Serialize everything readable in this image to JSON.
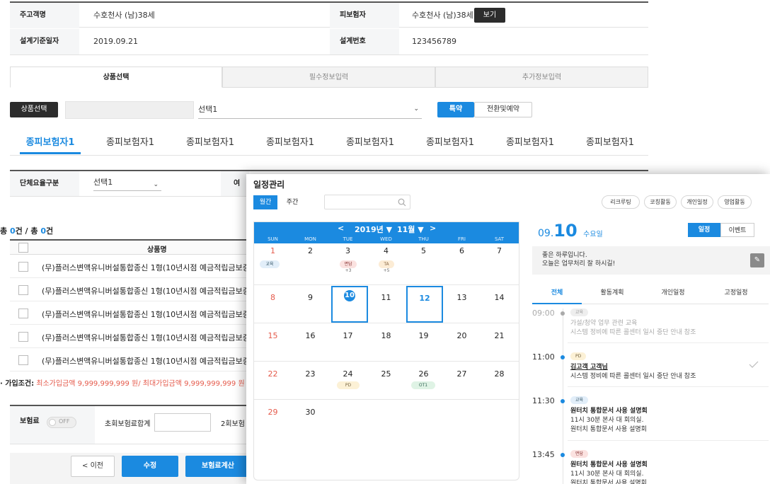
{
  "colors": {
    "accent": "#1b8ae0",
    "sunday": "#e55a4b",
    "dark_button": "#2c2c2c"
  },
  "info": {
    "customer_label": "주고객명",
    "customer_value": "수호천사 (남)38세",
    "insured_label": "피보험자",
    "insured_value": "수호천사 (남)38세",
    "view_button": "보기",
    "design_date_label": "설계기준일자",
    "design_date_value": "2019.09.21",
    "design_no_label": "설계번호",
    "design_no_value": "123456789"
  },
  "steps": [
    "상품선택",
    "필수정보입력",
    "추가정보입력"
  ],
  "product": {
    "select_button": "상품선택",
    "dropdown_value": "선택1",
    "rider_button": "특약",
    "convert_button": "전환및예약"
  },
  "insured_tabs": [
    "종피보험자1",
    "종피보험자1",
    "종피보험자1",
    "종피보험자1",
    "종피보험자1",
    "종피보험자1",
    "종피보험자1",
    "종피보험자1"
  ],
  "group_rate": {
    "label": "단체요율구분",
    "value": "선택1",
    "cut_label": "여"
  },
  "totals": {
    "prefix": "총 ",
    "count": "0",
    "mid": "건 / 총 ",
    "total": "0",
    "suffix": "건"
  },
  "table": {
    "header": "상품명",
    "rows": [
      "(무)플러스변액유니버설통합종신 1형(10년시점 예금적립금보증",
      "(무)플러스변액유니버설통합종신 1형(10년시점 예금적립금보증",
      "(무)플러스변액유니버설통합종신 1형(10년시점 예금적립금보증",
      "(무)플러스변액유니버설통합종신 1형(10년시점 예금적립금보증",
      "(무)플러스변액유니버설통합종신 1형(10년시점 예금적립금보증"
    ]
  },
  "join_condition": {
    "label": "· 가입조건:",
    "value": "최소가입금액 9,999,999,999 원/ 최대가입금액 9,999,999,999 원"
  },
  "premium": {
    "label": "보험료",
    "toggle": "OFF",
    "first_total_label": "초회보험료합계",
    "second_label": "2회보험"
  },
  "footer": {
    "prev": "< 이전",
    "edit": "수정",
    "calc": "보험료계산"
  },
  "schedule": {
    "title": "일정관리",
    "view_month": "월간",
    "view_week": "주간",
    "filters": [
      "리크루팅",
      "코칭활동",
      "개인일정",
      "영업활동"
    ],
    "calendar": {
      "prev": "<",
      "year": "2019년 ▼",
      "month": "11월 ▼",
      "next": ">",
      "weekdays": [
        "SUN",
        "MON",
        "TUE",
        "WED",
        "THU",
        "FRI",
        "SAT"
      ],
      "days": [
        "1",
        "2",
        "3",
        "4",
        "5",
        "6",
        "7",
        "8",
        "9",
        "10",
        "11",
        "12",
        "13",
        "14",
        "15",
        "16",
        "17",
        "18",
        "19",
        "20",
        "21",
        "22",
        "23",
        "24",
        "25",
        "26",
        "27",
        "28",
        "29",
        "30"
      ],
      "events": [
        {
          "label": "교육"
        },
        {
          "label": "면담",
          "more": "+3"
        },
        {
          "label": "TA",
          "more": "+5"
        },
        {
          "label": "PD"
        },
        {
          "label": "OT1"
        }
      ]
    },
    "side": {
      "month": "09.",
      "day": "10",
      "weekday": "수요일",
      "mode_schedule": "일정",
      "mode_event": "이벤트",
      "greeting1": "좋은 하루입니다.",
      "greeting2": "오늘은 업무처리 잘 하시길!",
      "tabs": [
        "전체",
        "활동계획",
        "개인일정",
        "고정일정"
      ],
      "items": [
        {
          "time": "09:00",
          "tag": "교육",
          "title": "가설/청약 업무 관련 교육",
          "sub1": "시스템 정비에 따른 콜센터 일시 중단 안내 참조",
          "sub2": ""
        },
        {
          "time": "11:00",
          "tag": "PD",
          "title": "김고객 고객님",
          "sub1": "시스템 정비에 따른 콜센터 일시 중단 안내 참조",
          "sub2": ""
        },
        {
          "time": "11:30",
          "tag": "교육",
          "title": "원터치 통합문서 사용 설명회",
          "sub1": "11시 30분 본사 대 회의실.",
          "sub2": "원터치 통합문서 사용 설명회"
        },
        {
          "time": "13:45",
          "tag": "면담",
          "title": "원터치 통합문서 사용 설명회",
          "sub1": "11시 30분 본사 대 회의실.",
          "sub2": "원터치 통합문서 사용 설명회"
        }
      ]
    }
  }
}
